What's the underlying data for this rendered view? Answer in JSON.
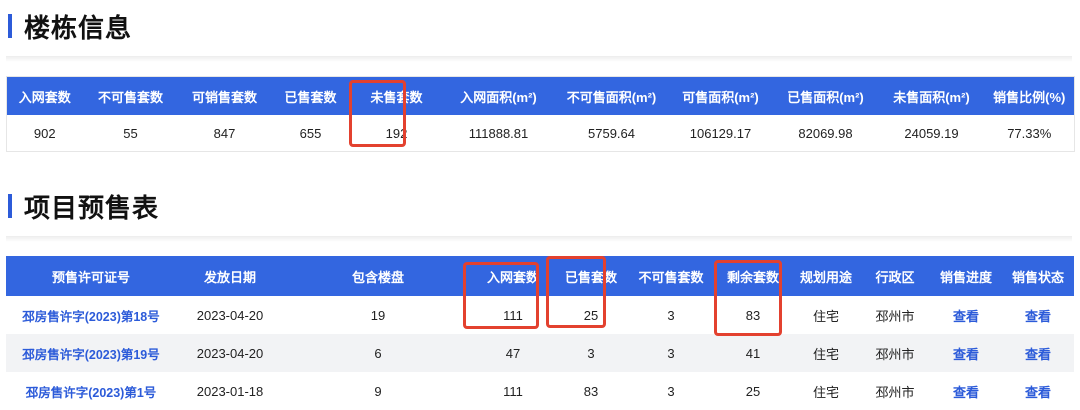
{
  "building_info": {
    "title": "楼栋信息",
    "headers": [
      "入网套数",
      "不可售套数",
      "可销售套数",
      "已售套数",
      "未售套数",
      "入网面积(m²)",
      "不可售面积(m²)",
      "可售面积(m²)",
      "已售面积(m²)",
      "未售面积(m²)",
      "销售比例(%)"
    ],
    "values": [
      "902",
      "55",
      "847",
      "655",
      "192",
      "111888.81",
      "5759.64",
      "106129.17",
      "82069.98",
      "24059.19",
      "77.33%"
    ]
  },
  "presale": {
    "title": "项目预售表",
    "headers": [
      "预售许可证号",
      "发放日期",
      "包含楼盘",
      "入网套数",
      "已售套数",
      "不可售套数",
      "剩余套数",
      "规划用途",
      "行政区",
      "销售进度",
      "销售状态"
    ],
    "rows": [
      [
        "邳房售许字(2023)第18号",
        "2023-04-20",
        "19",
        "111",
        "25",
        "3",
        "83",
        "住宅",
        "邳州市",
        "查看",
        "查看"
      ],
      [
        "邳房售许字(2023)第19号",
        "2023-04-20",
        "6",
        "47",
        "3",
        "3",
        "41",
        "住宅",
        "邳州市",
        "查看",
        "查看"
      ],
      [
        "邳房售许字(2023)第1号",
        "2023-01-18",
        "9",
        "111",
        "83",
        "3",
        "25",
        "住宅",
        "邳州市",
        "查看",
        "查看"
      ]
    ]
  },
  "colors": {
    "header_bg": "#3366e0",
    "link": "#2c5bd9",
    "highlight_box": "#e3412f",
    "title_bar": "#2c5bd9"
  }
}
